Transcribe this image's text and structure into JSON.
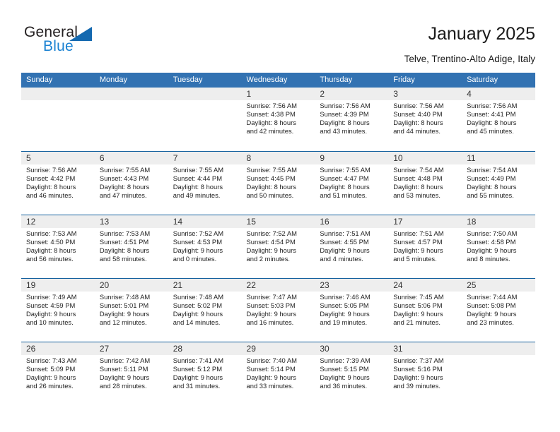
{
  "logo": {
    "word_one": "General",
    "word_two": "Blue",
    "triangle_color": "#1469b0",
    "blue_text_color": "#1b82d2"
  },
  "header": {
    "title": "January 2025",
    "location": "Telve, Trentino-Alto Adige, Italy"
  },
  "theme": {
    "header_row_bg": "#3272b2",
    "week_divider": "#14619e",
    "daynum_band_bg": "#eeeeee"
  },
  "weekdays": [
    "Sunday",
    "Monday",
    "Tuesday",
    "Wednesday",
    "Thursday",
    "Friday",
    "Saturday"
  ],
  "weeks": [
    [
      {
        "day": "",
        "lines": []
      },
      {
        "day": "",
        "lines": []
      },
      {
        "day": "",
        "lines": []
      },
      {
        "day": "1",
        "lines": [
          "Sunrise: 7:56 AM",
          "Sunset: 4:38 PM",
          "Daylight: 8 hours",
          "and 42 minutes."
        ]
      },
      {
        "day": "2",
        "lines": [
          "Sunrise: 7:56 AM",
          "Sunset: 4:39 PM",
          "Daylight: 8 hours",
          "and 43 minutes."
        ]
      },
      {
        "day": "3",
        "lines": [
          "Sunrise: 7:56 AM",
          "Sunset: 4:40 PM",
          "Daylight: 8 hours",
          "and 44 minutes."
        ]
      },
      {
        "day": "4",
        "lines": [
          "Sunrise: 7:56 AM",
          "Sunset: 4:41 PM",
          "Daylight: 8 hours",
          "and 45 minutes."
        ]
      }
    ],
    [
      {
        "day": "5",
        "lines": [
          "Sunrise: 7:56 AM",
          "Sunset: 4:42 PM",
          "Daylight: 8 hours",
          "and 46 minutes."
        ]
      },
      {
        "day": "6",
        "lines": [
          "Sunrise: 7:55 AM",
          "Sunset: 4:43 PM",
          "Daylight: 8 hours",
          "and 47 minutes."
        ]
      },
      {
        "day": "7",
        "lines": [
          "Sunrise: 7:55 AM",
          "Sunset: 4:44 PM",
          "Daylight: 8 hours",
          "and 49 minutes."
        ]
      },
      {
        "day": "8",
        "lines": [
          "Sunrise: 7:55 AM",
          "Sunset: 4:45 PM",
          "Daylight: 8 hours",
          "and 50 minutes."
        ]
      },
      {
        "day": "9",
        "lines": [
          "Sunrise: 7:55 AM",
          "Sunset: 4:47 PM",
          "Daylight: 8 hours",
          "and 51 minutes."
        ]
      },
      {
        "day": "10",
        "lines": [
          "Sunrise: 7:54 AM",
          "Sunset: 4:48 PM",
          "Daylight: 8 hours",
          "and 53 minutes."
        ]
      },
      {
        "day": "11",
        "lines": [
          "Sunrise: 7:54 AM",
          "Sunset: 4:49 PM",
          "Daylight: 8 hours",
          "and 55 minutes."
        ]
      }
    ],
    [
      {
        "day": "12",
        "lines": [
          "Sunrise: 7:53 AM",
          "Sunset: 4:50 PM",
          "Daylight: 8 hours",
          "and 56 minutes."
        ]
      },
      {
        "day": "13",
        "lines": [
          "Sunrise: 7:53 AM",
          "Sunset: 4:51 PM",
          "Daylight: 8 hours",
          "and 58 minutes."
        ]
      },
      {
        "day": "14",
        "lines": [
          "Sunrise: 7:52 AM",
          "Sunset: 4:53 PM",
          "Daylight: 9 hours",
          "and 0 minutes."
        ]
      },
      {
        "day": "15",
        "lines": [
          "Sunrise: 7:52 AM",
          "Sunset: 4:54 PM",
          "Daylight: 9 hours",
          "and 2 minutes."
        ]
      },
      {
        "day": "16",
        "lines": [
          "Sunrise: 7:51 AM",
          "Sunset: 4:55 PM",
          "Daylight: 9 hours",
          "and 4 minutes."
        ]
      },
      {
        "day": "17",
        "lines": [
          "Sunrise: 7:51 AM",
          "Sunset: 4:57 PM",
          "Daylight: 9 hours",
          "and 5 minutes."
        ]
      },
      {
        "day": "18",
        "lines": [
          "Sunrise: 7:50 AM",
          "Sunset: 4:58 PM",
          "Daylight: 9 hours",
          "and 8 minutes."
        ]
      }
    ],
    [
      {
        "day": "19",
        "lines": [
          "Sunrise: 7:49 AM",
          "Sunset: 4:59 PM",
          "Daylight: 9 hours",
          "and 10 minutes."
        ]
      },
      {
        "day": "20",
        "lines": [
          "Sunrise: 7:48 AM",
          "Sunset: 5:01 PM",
          "Daylight: 9 hours",
          "and 12 minutes."
        ]
      },
      {
        "day": "21",
        "lines": [
          "Sunrise: 7:48 AM",
          "Sunset: 5:02 PM",
          "Daylight: 9 hours",
          "and 14 minutes."
        ]
      },
      {
        "day": "22",
        "lines": [
          "Sunrise: 7:47 AM",
          "Sunset: 5:03 PM",
          "Daylight: 9 hours",
          "and 16 minutes."
        ]
      },
      {
        "day": "23",
        "lines": [
          "Sunrise: 7:46 AM",
          "Sunset: 5:05 PM",
          "Daylight: 9 hours",
          "and 19 minutes."
        ]
      },
      {
        "day": "24",
        "lines": [
          "Sunrise: 7:45 AM",
          "Sunset: 5:06 PM",
          "Daylight: 9 hours",
          "and 21 minutes."
        ]
      },
      {
        "day": "25",
        "lines": [
          "Sunrise: 7:44 AM",
          "Sunset: 5:08 PM",
          "Daylight: 9 hours",
          "and 23 minutes."
        ]
      }
    ],
    [
      {
        "day": "26",
        "lines": [
          "Sunrise: 7:43 AM",
          "Sunset: 5:09 PM",
          "Daylight: 9 hours",
          "and 26 minutes."
        ]
      },
      {
        "day": "27",
        "lines": [
          "Sunrise: 7:42 AM",
          "Sunset: 5:11 PM",
          "Daylight: 9 hours",
          "and 28 minutes."
        ]
      },
      {
        "day": "28",
        "lines": [
          "Sunrise: 7:41 AM",
          "Sunset: 5:12 PM",
          "Daylight: 9 hours",
          "and 31 minutes."
        ]
      },
      {
        "day": "29",
        "lines": [
          "Sunrise: 7:40 AM",
          "Sunset: 5:14 PM",
          "Daylight: 9 hours",
          "and 33 minutes."
        ]
      },
      {
        "day": "30",
        "lines": [
          "Sunrise: 7:39 AM",
          "Sunset: 5:15 PM",
          "Daylight: 9 hours",
          "and 36 minutes."
        ]
      },
      {
        "day": "31",
        "lines": [
          "Sunrise: 7:37 AM",
          "Sunset: 5:16 PM",
          "Daylight: 9 hours",
          "and 39 minutes."
        ]
      },
      {
        "day": "",
        "lines": []
      }
    ]
  ]
}
